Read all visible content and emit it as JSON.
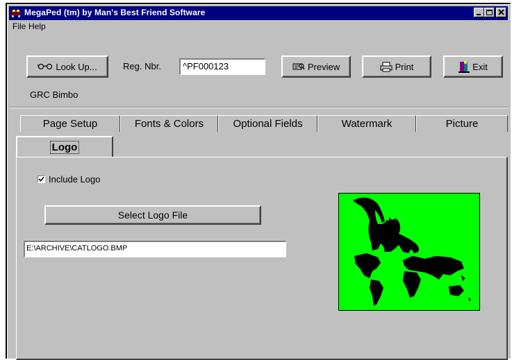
{
  "window": {
    "title": "MegaPed (tm) by Man's Best Friend Software",
    "controls": [
      "minimize-icon",
      "maximize-icon",
      "close-icon"
    ]
  },
  "menu": {
    "file": "File",
    "help": "Help"
  },
  "toolbar": {
    "lookup_label": "Look Up...",
    "reg_label": "Reg. Nbr.",
    "reg_value": "^PF000123",
    "preview_label": "Preview",
    "print_label": "Print",
    "exit_label": "Exit",
    "dog_name": "GRC Bimbo"
  },
  "tabs": {
    "page_setup": "Page Setup",
    "fonts_colors": "Fonts & Colors",
    "optional_fields": "Optional Fields",
    "watermark": "Watermark",
    "picture": "Picture",
    "logo": "Logo"
  },
  "logo_panel": {
    "include_logo_label": "Include Logo",
    "include_logo_checked": true,
    "select_button_label": "Select Logo File",
    "file_path": "E:\\ARCHIVE\\CATLOGO.BMP",
    "logo_background": "#00ff00"
  },
  "colors": {
    "titlebar": "#000080",
    "face": "#c0c0c0"
  }
}
